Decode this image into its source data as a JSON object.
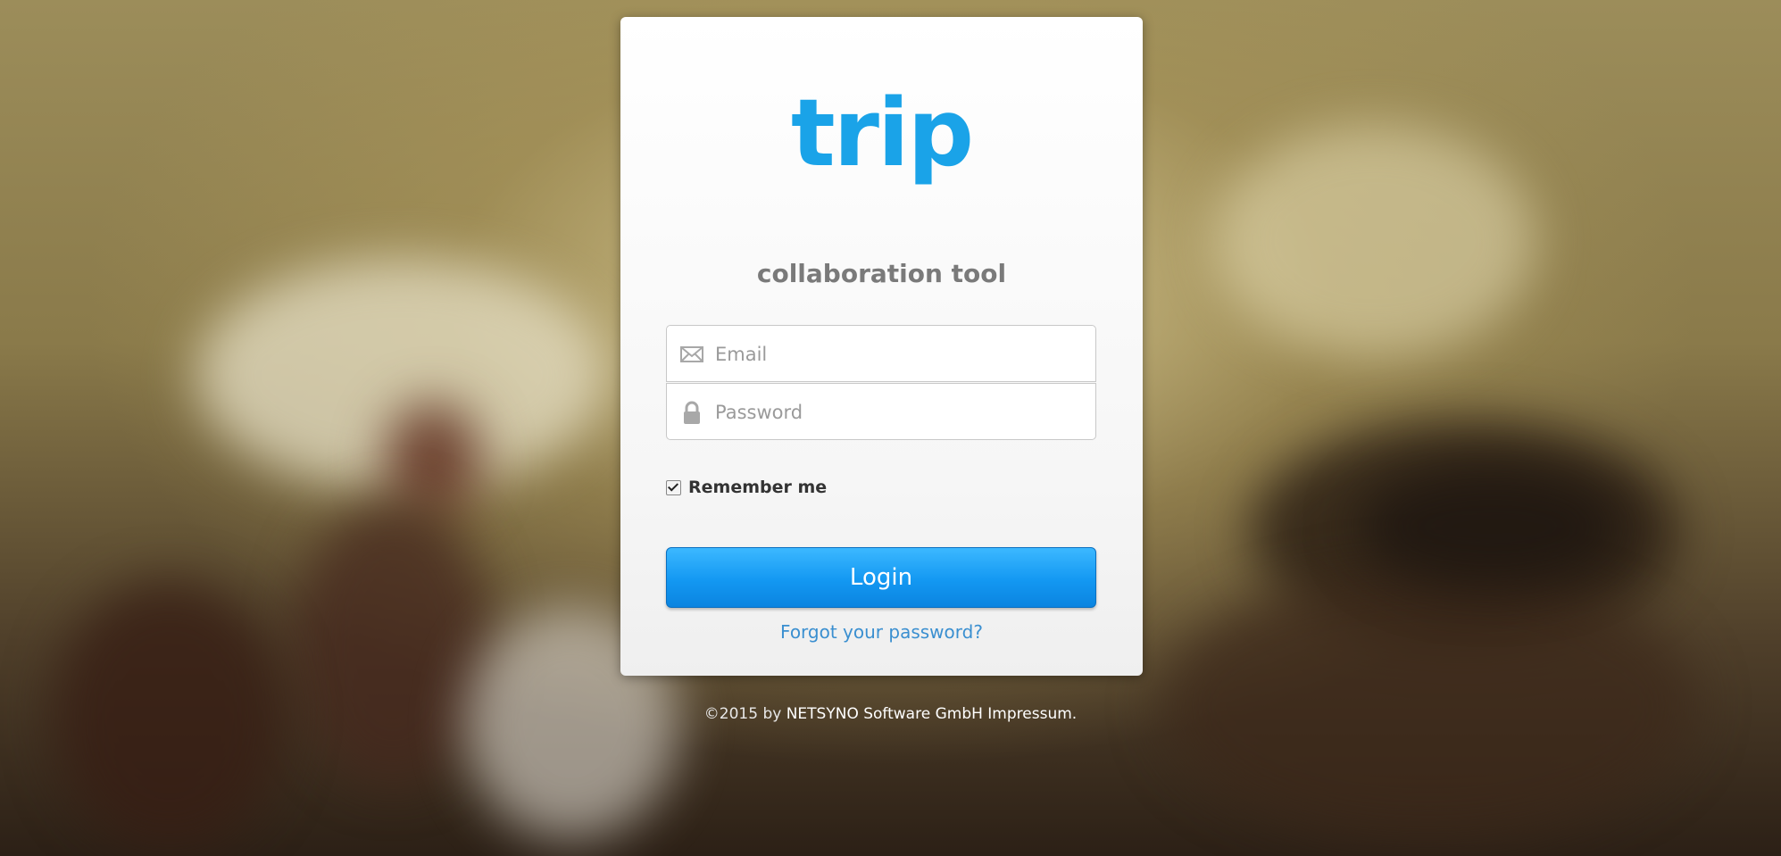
{
  "app": {
    "logo_text": "trip",
    "tagline": "collaboration tool"
  },
  "form": {
    "email_placeholder": "Email",
    "password_placeholder": "Password",
    "remember_label": "Remember me",
    "remember_checked": true,
    "login_label": "Login",
    "forgot_label": "Forgot your password?"
  },
  "icons": {
    "email": "envelope-icon",
    "password": "lock-icon"
  },
  "footer": {
    "copyright": "©2015 by",
    "company": "NETSYNO Software GmbH",
    "imprint": "Impressum."
  },
  "colors": {
    "brand": "#1aa3e8",
    "button": "#1398f2",
    "link": "#3a8fd0"
  }
}
